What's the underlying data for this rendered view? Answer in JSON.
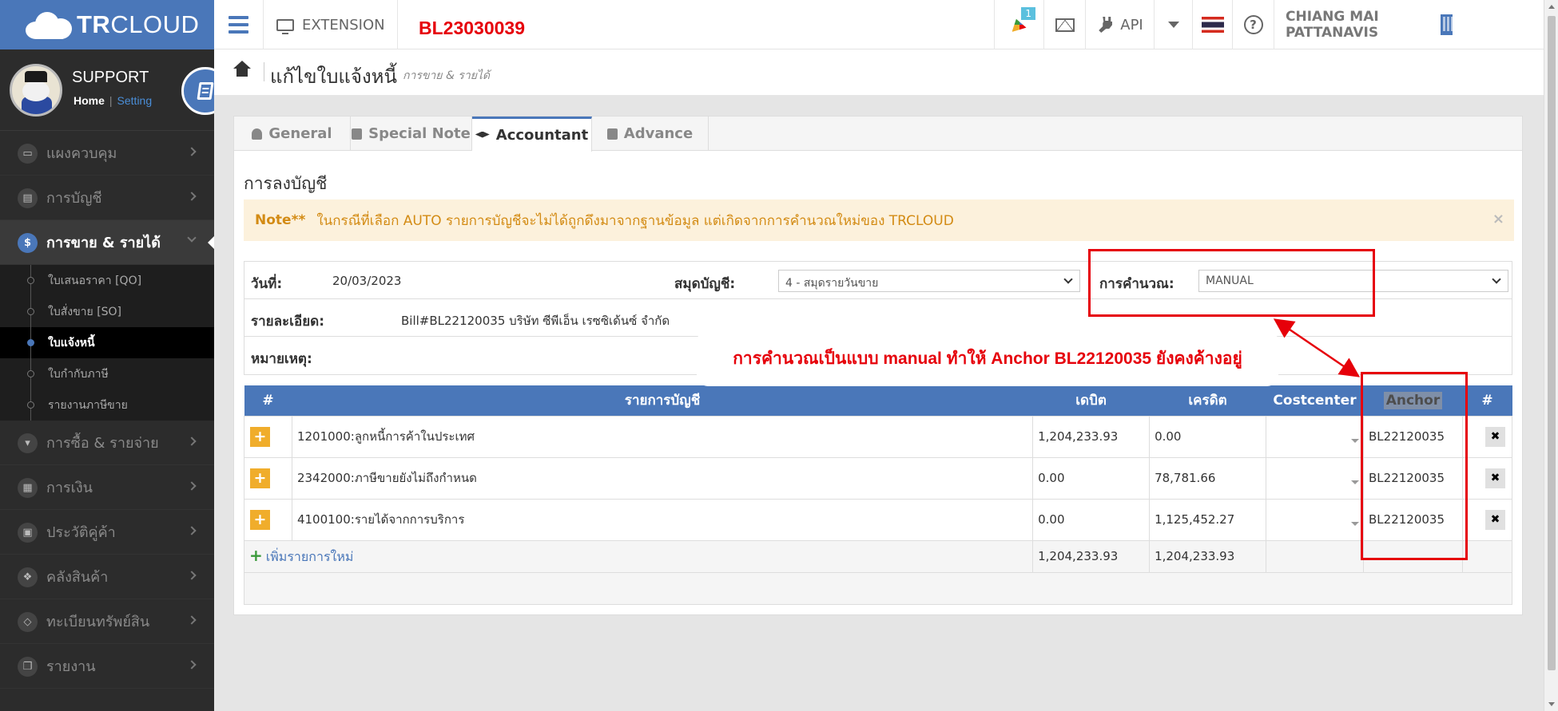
{
  "brand": {
    "strong": "TR",
    "light": "CLOUD"
  },
  "topbar": {
    "extension_label": "EXTENSION",
    "document_number": "BL23030039",
    "notification_count": "1",
    "api_label": "API",
    "company_name": "CHIANG MAI PATTANAVIS"
  },
  "profile": {
    "name": "SUPPORT",
    "home_link": "Home",
    "separator": "|",
    "setting_link": "Setting"
  },
  "sidebar": {
    "items": [
      {
        "label": "แผงควบคุม",
        "icon": "monitor-icon"
      },
      {
        "label": "การบัญชี",
        "icon": "book-icon"
      },
      {
        "label": "การขาย & รายได้",
        "icon": "dollar-icon",
        "icon_text": "$"
      },
      {
        "label": "การซื้อ & รายจ่าย",
        "icon": "cart-icon"
      },
      {
        "label": "การเงิน",
        "icon": "calendar-icon"
      },
      {
        "label": "ประวัติคู่ค้า",
        "icon": "contact-icon"
      },
      {
        "label": "คลังสินค้า",
        "icon": "cubes-icon"
      },
      {
        "label": "ทะเบียนทรัพย์สิน",
        "icon": "diamond-icon"
      },
      {
        "label": "รายงาน",
        "icon": "copy-icon"
      }
    ],
    "sub_items": [
      {
        "label": "ใบเสนอราคา [QO]"
      },
      {
        "label": "ใบสั่งขาย [SO]"
      },
      {
        "label": "ใบแจ้งหนี้"
      },
      {
        "label": "ใบกำกับภาษี"
      },
      {
        "label": "รายงานภาษีขาย"
      }
    ]
  },
  "page": {
    "title": "แก้ไขใบแจ้งหนี้",
    "subtitle": "การขาย & รายได้"
  },
  "tabs": [
    {
      "label": "General"
    },
    {
      "label": "Special Note"
    },
    {
      "label": "Accountant"
    },
    {
      "label": "Advance"
    }
  ],
  "section_title": "การลงบัญชี",
  "note": {
    "prefix": "Note**",
    "text": "ในกรณีที่เลือก AUTO รายการบัญชีจะไม่ได้ถูกดึงมาจากฐานข้อมูล แต่เกิดจากการคำนวณใหม่ของ TRCLOUD",
    "close": "×"
  },
  "form": {
    "date_label": "วันที่:",
    "date_value": "20/03/2023",
    "journal_label": "สมุดบัญชี:",
    "journal_value": "4 - สมุดรายวันขาย",
    "calc_label": "การคำนวณ:",
    "calc_value": "MANUAL",
    "detail_label": "รายละเอียด:",
    "detail_value": "Bill#BL22120035  บริษัท ซีพีเอ็น เรซซิเด้นซ์ จำกัด",
    "remark_label": "หมายเหตุ:"
  },
  "table": {
    "headers": {
      "no": "#",
      "account": "รายการบัญชี",
      "debit": "เดบิต",
      "credit": "เครดิต",
      "costcenter": "Costcenter",
      "anchor": "Anchor",
      "action": "#"
    },
    "rows": [
      {
        "account": "1201000:ลูกหนี้การค้าในประเทศ",
        "debit": "1,204,233.93",
        "credit": "0.00",
        "anchor": "BL22120035"
      },
      {
        "account": "2342000:ภาษีขายยังไม่ถึงกำหนด",
        "debit": "0.00",
        "credit": "78,781.66",
        "anchor": "BL22120035"
      },
      {
        "account": "4100100:รายได้จากการบริการ",
        "debit": "0.00",
        "credit": "1,125,452.27",
        "anchor": "BL22120035"
      }
    ],
    "add_row_label": "เพิ่มรายการใหม่",
    "total_debit": "1,204,233.93",
    "total_credit": "1,204,233.93"
  },
  "annotation": {
    "text": "การคำนวณเป็นแบบ manual ทำให้ Anchor BL22120035 ยังคงค้างอยู่",
    "color": "#e6000a"
  },
  "colors": {
    "primary": "#4a77b9",
    "sidebar": "#2c2c2c",
    "warning_bg": "#fcf1dc",
    "warning_text": "#d38b14",
    "add_button": "#f0ad2b"
  }
}
